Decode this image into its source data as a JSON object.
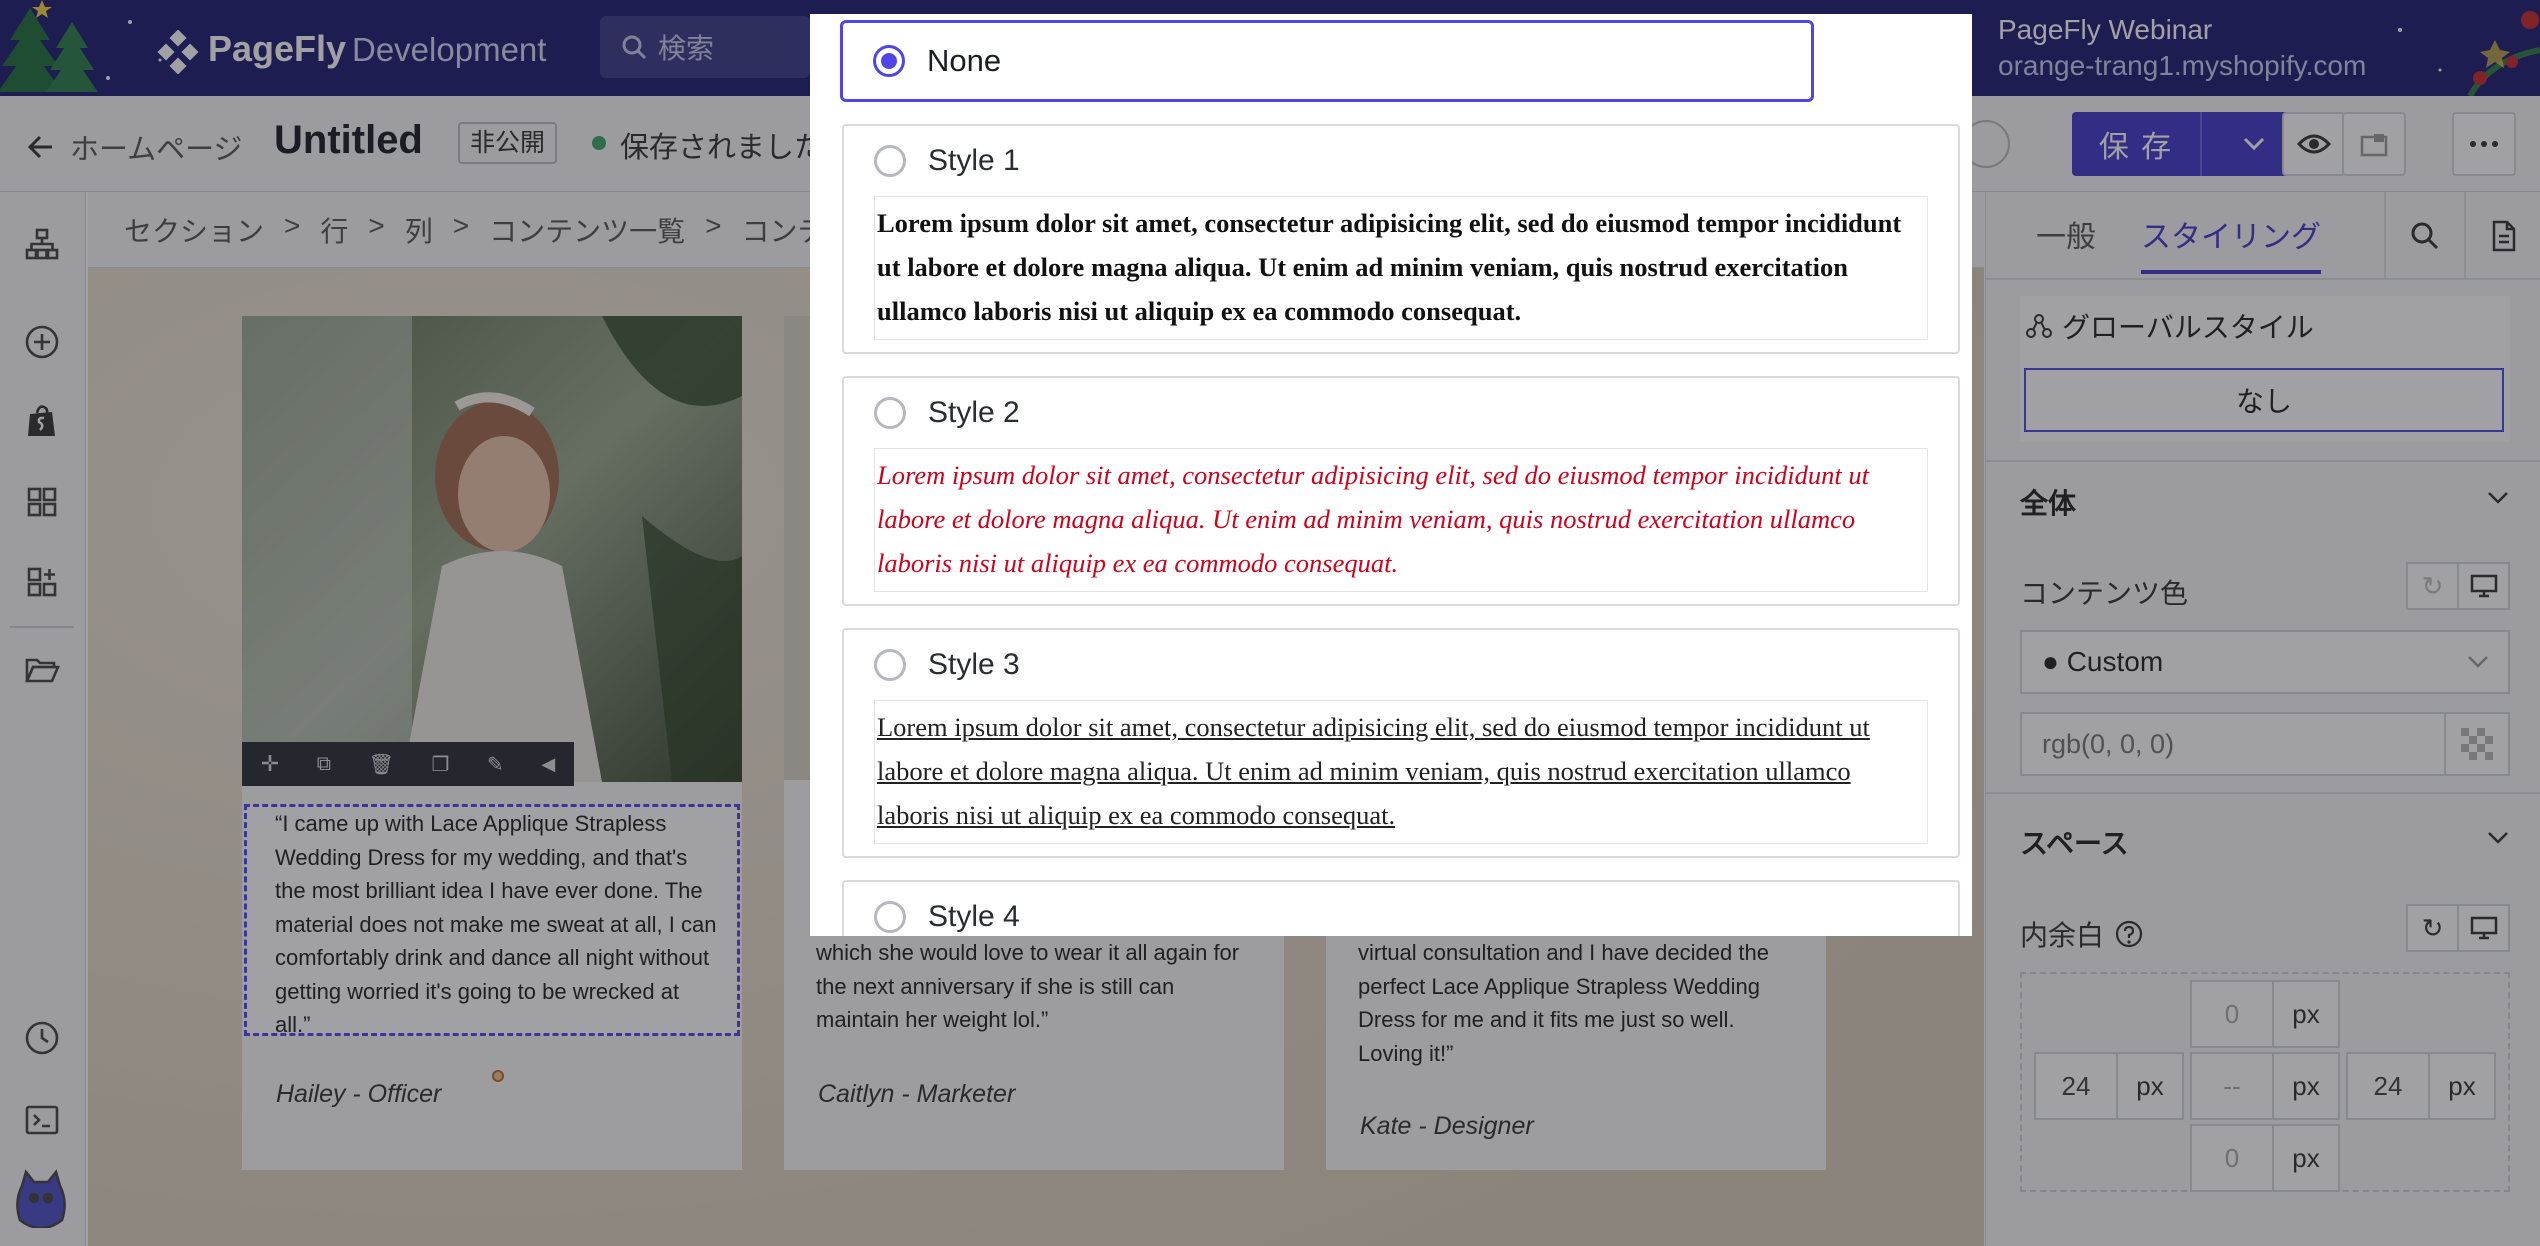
{
  "header": {
    "brand": "PageFly",
    "brand_suffix": "Development",
    "search_placeholder": "検索",
    "store_name": "PageFly Webinar",
    "store_domain": "orange-trang1.myshopify.com"
  },
  "toolbar": {
    "back_label": "ホームページ",
    "page_title": "Untitled",
    "visibility_badge": "非公開",
    "save_status": "保存されました",
    "save_label": "保 存"
  },
  "breadcrumb": [
    "セクション",
    "行",
    "列",
    "コンテンツ一覧",
    "コンテ"
  ],
  "testimonials": [
    {
      "text": "“I came up with Lace Applique Strapless Wedding Dress for my wedding, and that's the most brilliant idea I have ever done. The material does not make me sweat at all, I can comfortably drink and dance all night without getting worried it's going to be wrecked at all.”",
      "author": "Hailey - Officer"
    },
    {
      "text": "which she would love to wear it all again for the next anniversary if she is still can maintain her weight lol.”",
      "author": "Caitlyn - Marketer"
    },
    {
      "text": "virtual consultation and I have decided the perfect Lace Applique Strapless Wedding Dress for me and it fits me just so well. Loving it!”",
      "author": "Kate - Designer"
    }
  ],
  "dialog": {
    "options": [
      {
        "label": "None",
        "selected": true
      },
      {
        "label": "Style 1",
        "sample": "Lorem ipsum dolor sit amet, consectetur adipisicing elit, sed do eiusmod tempor incididunt ut labore et dolore magna aliqua. Ut enim ad minim veniam, quis nostrud exercitation ullamco laboris nisi ut aliquip ex ea commodo consequat."
      },
      {
        "label": "Style 2",
        "sample": "Lorem ipsum dolor sit amet, consectetur adipisicing elit, sed do eiusmod tempor incididunt ut labore et dolore magna aliqua. Ut enim ad minim veniam, quis nostrud exercitation ullamco laboris nisi ut aliquip ex ea commodo consequat.",
        "color": "#d0021b"
      },
      {
        "label": "Style 3",
        "sample": "Lorem ipsum dolor sit amet, consectetur adipisicing elit, sed do eiusmod tempor incididunt ut labore et dolore magna aliqua. Ut enim ad minim veniam, quis nostrud exercitation ullamco laboris nisi ut aliquip ex ea commodo consequat."
      },
      {
        "label": "Style 4"
      }
    ]
  },
  "panel": {
    "tab_general": "一般",
    "tab_styling": "スタイリング",
    "global_style_label": "グローバルスタイル",
    "global_style_value": "なし",
    "section_overall": "全体",
    "content_color_label": "コンテンツ色",
    "color_select_value": "● Custom",
    "color_input_placeholder": "rgb(0, 0, 0)",
    "section_space": "スペース",
    "padding_label": "内余白",
    "padding": {
      "top": "0",
      "left": "24",
      "center": "--",
      "right": "24",
      "bottom": "0",
      "unit": "px"
    }
  },
  "colors": {
    "accent": "#5046e5",
    "header_bg": "#1c1d6e",
    "save_button": "#4338ca",
    "style2_red": "#d0021b"
  }
}
